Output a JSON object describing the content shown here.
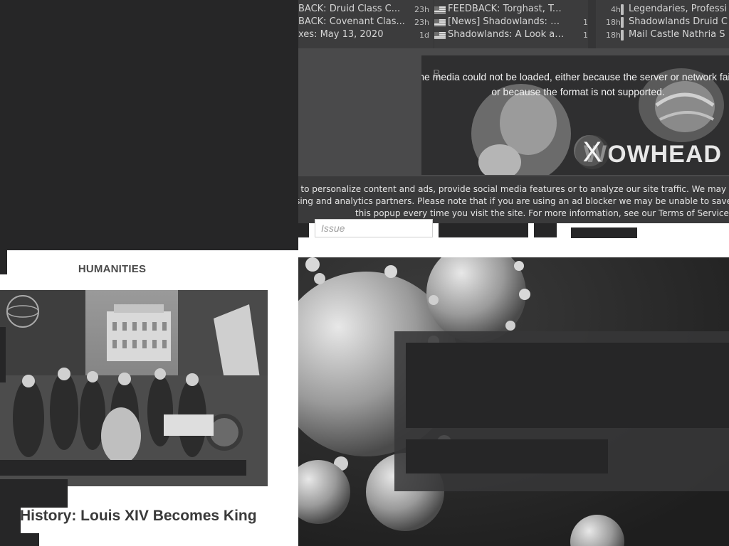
{
  "news": {
    "col1": [
      {
        "title": "BACK: Druid Class C...",
        "age": "23h"
      },
      {
        "title": "BACK: Covenant Clas...",
        "age": "23h"
      },
      {
        "title": "xes: May 13, 2020",
        "age": "1d"
      }
    ],
    "col2": [
      {
        "title": "FEEDBACK: Torghast, Tow...",
        "age": "4h"
      },
      {
        "title": "[News] Shadowlands: A L...",
        "age": "18h"
      },
      {
        "title": "Shadowlands: A Look at C...",
        "age": "18h"
      }
    ],
    "col3": [
      {
        "title": "Legendaries, Professi"
      },
      {
        "title": "Shadowlands Druid C"
      },
      {
        "title": "Mail Castle Nathria S"
      }
    ]
  },
  "video": {
    "bg_text": "B",
    "error_message": "The media could not be loaded, either because the server or network failed or because the format is not supported.",
    "close_label": "X",
    "logo_text": "WOWHEAD"
  },
  "cookie": {
    "lines": [
      "ookies to personalize content and ads, provide social media features or to analyze our site traffic. We may als",
      "dvertising and analytics partners. Please note that if you are using an ad blocker we may be unable to save a c",
      "this popup every time you visit the site. For more information, see our Terms of Service ar"
    ]
  },
  "search": {
    "placeholder": "Issue"
  },
  "card": {
    "category": "HUMANITIES",
    "title": "History: Louis XIV Becomes King"
  }
}
